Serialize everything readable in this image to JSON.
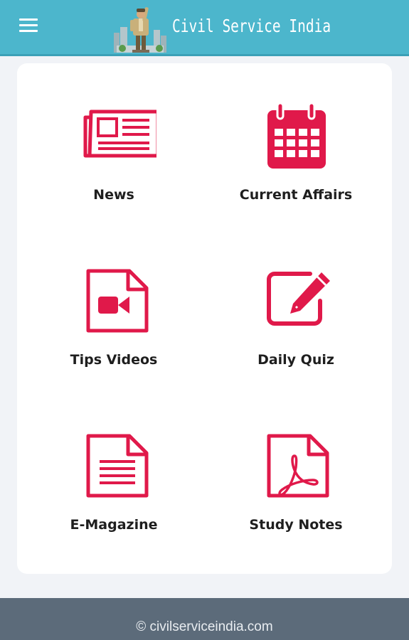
{
  "header": {
    "brand_title": "Civil Service India",
    "menu_icon": "hamburger-menu-icon",
    "logo_icon": "officer-figure-logo"
  },
  "tiles": [
    {
      "label": "News",
      "icon": "newspaper-icon"
    },
    {
      "label": "Current Affairs",
      "icon": "calendar-icon"
    },
    {
      "label": "Tips Videos",
      "icon": "video-file-icon"
    },
    {
      "label": "Daily Quiz",
      "icon": "edit-pencil-icon"
    },
    {
      "label": "E-Magazine",
      "icon": "document-icon"
    },
    {
      "label": "Study Notes",
      "icon": "pdf-file-icon"
    }
  ],
  "footer": {
    "copyright": "© civilserviceindia.com"
  },
  "colors": {
    "header_bg": "#4cb6cc",
    "icon_accent": "#e0194a",
    "footer_bg": "#5c6b7a",
    "page_bg": "#f1f3f7"
  }
}
